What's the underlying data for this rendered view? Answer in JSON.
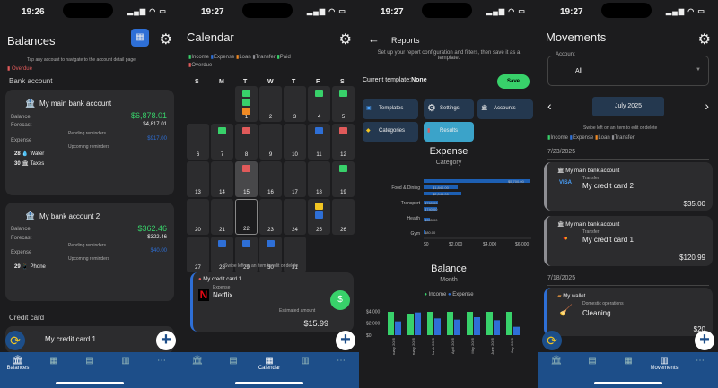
{
  "status": {
    "time1": "19:26",
    "time2": "19:27",
    "time3": "19:27",
    "time4": "19:27",
    "signal": "▂▄▆ ◠ ▭"
  },
  "balances": {
    "title": "Balances",
    "hint": "Tap any account to navigate to the account detail page",
    "overdue": "Overdue",
    "section_bank": "Bank account",
    "accounts": [
      {
        "name": "My main bank account",
        "balance_label": "Balance",
        "balance": "$6,878.01",
        "forecast_label": "Forecast",
        "forecast": "$4,817.01",
        "pending": "Pending reminders",
        "expense_label": "Expense",
        "expense": "$917.00",
        "upcoming": "Upcoming reminders",
        "r1_day": "28",
        "r1_name": "Water",
        "r2_day": "30",
        "r2_name": "Taxes"
      },
      {
        "name": "My bank account 2",
        "balance_label": "Balance",
        "balance": "$362.46",
        "forecast_label": "Forecast",
        "forecast": "$322.46",
        "pending": "Pending reminders",
        "expense_label": "Expense",
        "expense": "$40.00",
        "upcoming": "Upcoming reminders",
        "r1_day": "29",
        "r1_name": "Phone"
      }
    ],
    "section_credit": "Credit card",
    "credit_item": "My credit card 1"
  },
  "calendar": {
    "title": "Calendar",
    "legend": [
      "Income",
      "Expense",
      "Loan",
      "Transfer",
      "Paid",
      "Overdue"
    ],
    "weekdays": [
      "S",
      "M",
      "T",
      "W",
      "T",
      "F",
      "S"
    ],
    "days": [
      "1",
      "2",
      "3",
      "4",
      "5",
      "6",
      "7",
      "8",
      "9",
      "10",
      "11",
      "12",
      "13",
      "14",
      "15",
      "16",
      "17",
      "18",
      "19",
      "20",
      "21",
      "22",
      "23",
      "24",
      "25",
      "26",
      "27",
      "28",
      "29",
      "30",
      "31"
    ],
    "hint": "Swipe left on an item to edit or delete",
    "item_account": "My credit card 1",
    "item_type": "Expense",
    "item_name": "Netflix",
    "item_est_label": "Estimated amount",
    "item_amount": "$15.99"
  },
  "reports": {
    "title": "Reports",
    "desc": "Set up your report configuration and filters, then save it as a template.",
    "current_label": "Current template:",
    "current_value": "None",
    "save": "Save",
    "buttons": [
      "Templates",
      "Settings",
      "Accounts",
      "Categories",
      "Results"
    ],
    "expense_title": "Expense",
    "expense_sub": "Category",
    "expense_cats": [
      "Food & Dining",
      "Transport",
      "Health",
      "Gym"
    ],
    "expense_labels": [
      "$5,700.00",
      "$1,840.00",
      "$2,045.00",
      "$760.00",
      "$740.00",
      "$355.00",
      "$80.00"
    ],
    "expense_ticks": [
      "$0",
      "$2,000",
      "$4,000",
      "$6,000"
    ],
    "balance_title": "Balance",
    "balance_sub": "Month",
    "balance_legend": [
      "Income",
      "Expense"
    ],
    "balance_yticks": [
      "$4,000",
      "$2,000",
      "$0"
    ],
    "months": [
      "January 2025",
      "February 2025",
      "March 2025",
      "April 2025",
      "May 2025",
      "June 2025",
      "July 2025"
    ],
    "income": [
      3900,
      3600,
      3900,
      3900,
      3900,
      3900,
      3900
    ],
    "expense": [
      2300,
      3800,
      2800,
      2600,
      3000,
      2500,
      1400
    ]
  },
  "movements": {
    "title": "Movements",
    "account_label": "Account",
    "account_value": "All",
    "month": "July 2025",
    "hint": "Swipe left on an item to edit or delete",
    "legend": [
      "Income",
      "Expense",
      "Loan",
      "Transfer"
    ],
    "date1": "7/23/2025",
    "m1_account": "My main bank account",
    "m1_type": "Transfer",
    "m1_name": "My credit card 2",
    "m1_amount": "$35.00",
    "m2_account": "My main bank account",
    "m2_type": "Transfer",
    "m2_name": "My credit card 1",
    "m2_amount": "$120.99",
    "date2": "7/18/2025",
    "m3_account": "My wallet",
    "m3_type": "Domestic operations",
    "m3_name": "Cleaning",
    "m3_amount": "$20"
  },
  "tabs": [
    "Balances",
    "Calendar",
    "Calendar",
    "Movements",
    "More"
  ],
  "colors": {
    "income": "#38d16a",
    "expense": "#2e6fd6",
    "loan": "#f08a24",
    "transfer": "#8e8e93",
    "paid": "#38d16a",
    "overdue": "#e05a5a",
    "tabbar": "#1d4e89"
  }
}
